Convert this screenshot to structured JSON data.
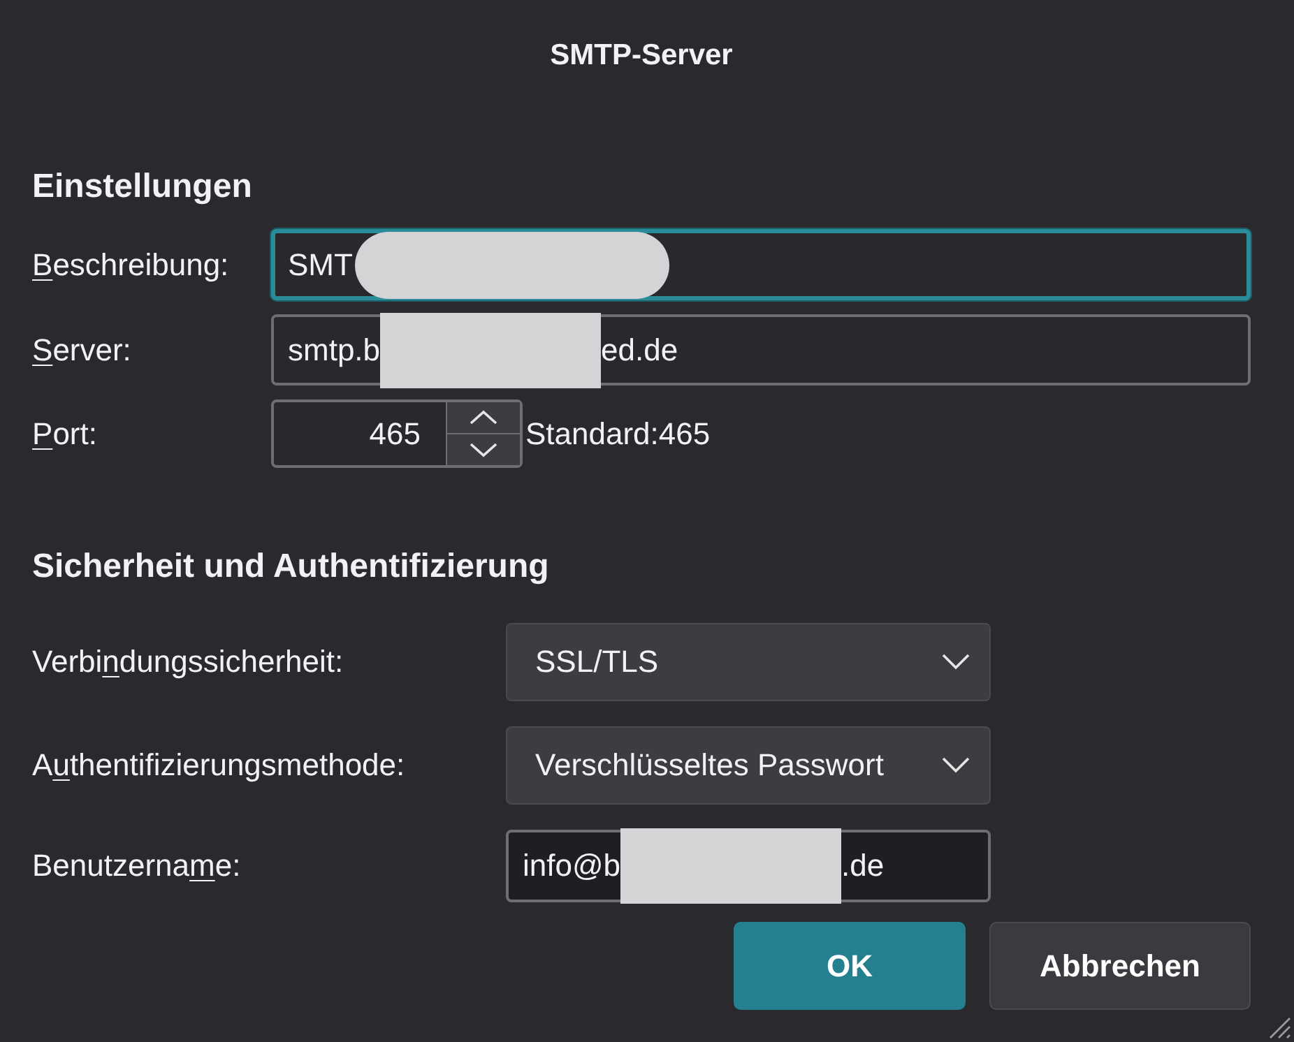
{
  "window": {
    "title": "SMTP-Server"
  },
  "settings": {
    "heading": "Einstellungen",
    "fields": [
      {
        "kind": "text",
        "label": {
          "key": "B",
          "after": "eschreibung:"
        },
        "focused": true,
        "segments": [
          {
            "text": "SMT",
            "redacted": true
          }
        ]
      },
      {
        "kind": "text",
        "label": {
          "key": "S",
          "after": "erver:"
        },
        "focused": false,
        "segments": [
          {
            "text": "smtp.b",
            "redacted": true
          },
          {
            "text": "ed.de",
            "redacted": false
          }
        ]
      },
      {
        "kind": "spin",
        "label": {
          "key": "P",
          "after": "ort:"
        },
        "value": "465",
        "default_text": "Standard:465"
      }
    ]
  },
  "security": {
    "heading": "Sicherheit und Authentifizierung",
    "fields": [
      {
        "kind": "select",
        "label": {
          "before": "Verbi",
          "key": "n",
          "after": "dungssicherheit:"
        },
        "value": "SSL/TLS"
      },
      {
        "kind": "select",
        "label": {
          "before": "A",
          "key": "u",
          "after": "thentifizierungsmethode:"
        },
        "value": "Verschlüsseltes Passwort"
      },
      {
        "kind": "text",
        "label": {
          "before": "Benutzerna",
          "key": "m",
          "after": "e:"
        },
        "focused": false,
        "segments": [
          {
            "text": "info@b",
            "redacted": true
          },
          {
            "text": ".de",
            "redacted": false
          }
        ]
      }
    ]
  },
  "buttons": [
    {
      "label": "OK",
      "kind": "primary"
    },
    {
      "label": "Abbrechen",
      "kind": "secondary"
    }
  ]
}
